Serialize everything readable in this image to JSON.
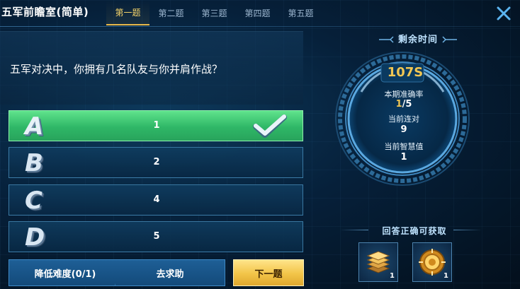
{
  "header": {
    "title": "五军前瞻室(简单)",
    "tabs": [
      {
        "label": "第一题",
        "active": true
      },
      {
        "label": "第二题",
        "active": false
      },
      {
        "label": "第三题",
        "active": false
      },
      {
        "label": "第四题",
        "active": false
      },
      {
        "label": "第五题",
        "active": false
      }
    ],
    "close_icon": "close-x-icon"
  },
  "question": {
    "text": "五军对决中，你拥有几名队友与你并肩作战？"
  },
  "options": [
    {
      "letter": "A",
      "text": "1",
      "state": "correct"
    },
    {
      "letter": "B",
      "text": "2",
      "state": "normal"
    },
    {
      "letter": "C",
      "text": "4",
      "state": "normal"
    },
    {
      "letter": "D",
      "text": "5",
      "state": "normal"
    }
  ],
  "buttons": {
    "lower_difficulty": "降低难度(0/1)",
    "ask_help": "去求助",
    "next": "下一题"
  },
  "status": {
    "time_title": "剩余时间",
    "time_value": "107S",
    "accuracy_label": "本期准确率",
    "accuracy_num": "1",
    "accuracy_den": "/5",
    "streak_label": "当前连对",
    "streak_value": "9",
    "wisdom_label": "当前智慧值",
    "wisdom_value": "1"
  },
  "rewards": {
    "title": "回答正确可获取",
    "items": [
      {
        "icon": "book-stack-icon",
        "count": "1"
      },
      {
        "icon": "gold-medal-icon",
        "count": "1"
      }
    ]
  },
  "colors": {
    "accent_gold": "#f1c653",
    "correct_green": "#2fb767",
    "panel_blue": "#134a7a"
  }
}
